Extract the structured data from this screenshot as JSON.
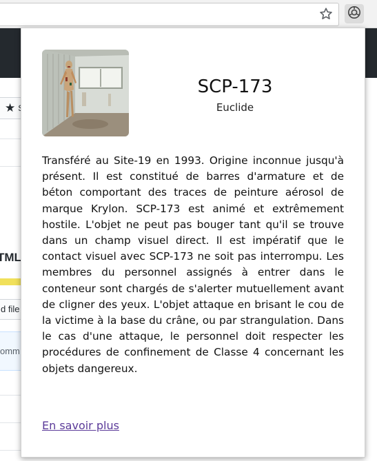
{
  "browser": {
    "star_icon": "star-outline-icon",
    "extension_icon": "scp-logo-icon"
  },
  "background_page": {
    "star_fragment": "S",
    "tml_fragment": "TML",
    "file_button_fragment": "d file",
    "commit_fragment": "omm",
    "language_bar_color": "#f1e05a",
    "header_color": "#24292e"
  },
  "popup": {
    "title": "SCP-173",
    "object_class": "Euclide",
    "description": "Transféré au Site-19 en 1993. Origine inconnue jusqu'à présent. Il est constitué de barres d'armature et de béton comportant des traces de peinture aérosol de marque Krylon. SCP-173 est animé et extrêmement hostile. L'objet ne peut pas bouger tant qu'il se trouve dans un champ visuel direct. Il est impératif que le contact visuel avec SCP-173 ne soit pas interrompu. Les membres du personnel assignés à entrer dans le conteneur sont chargés de s'alerter mutuellement avant de cligner des yeux. L'objet attaque en brisant le cou de la victime à la base du crâne, ou par strangulation. Dans le cas d'une attaque, le personnel doit respecter les procédures de confinement de Classe 4 concernant les objets dangereux.",
    "link_label": "En savoir plus",
    "link_color": "#5b3a99"
  }
}
